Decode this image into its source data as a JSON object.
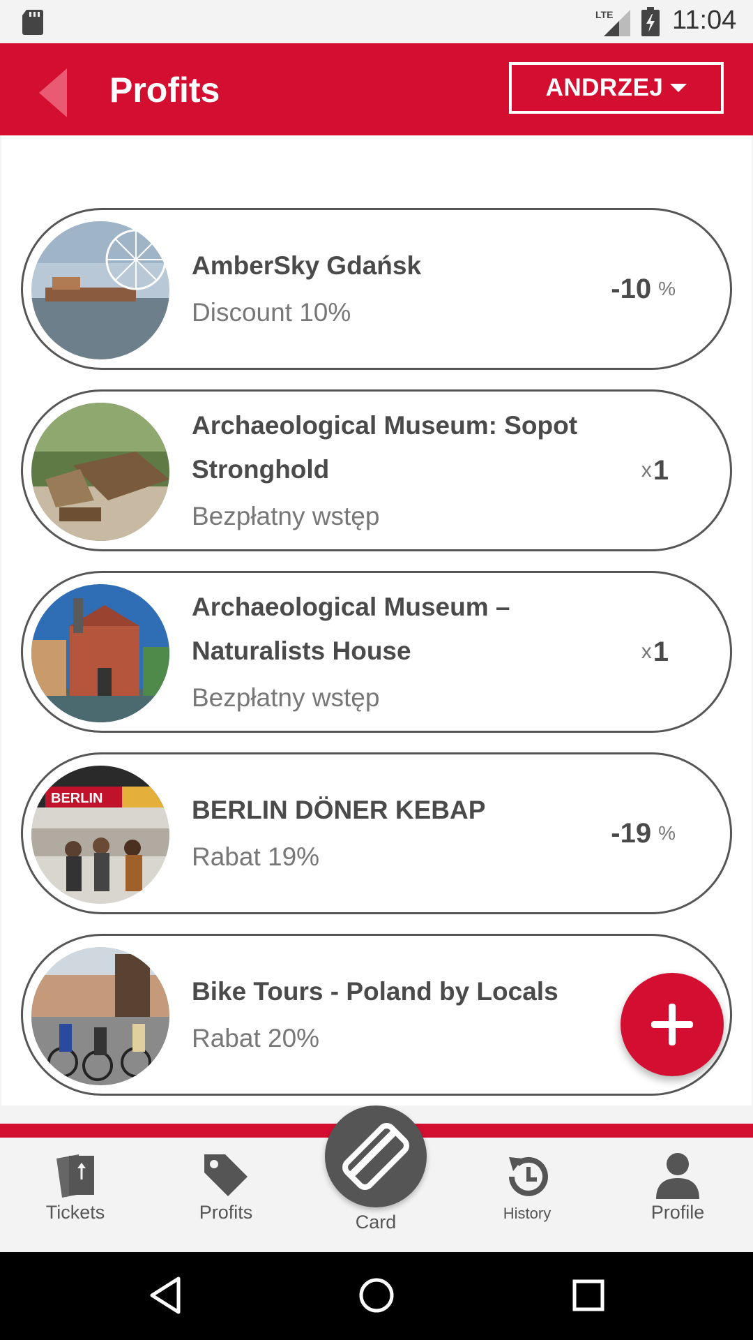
{
  "status_bar": {
    "time": "11:04",
    "network": "LTE"
  },
  "header": {
    "title": "Profits",
    "user_label": "ANDRZEJ"
  },
  "profits": [
    {
      "title": "AmberSky Gdańsk",
      "subtitle": "Discount 10%",
      "value": "-10",
      "unit": "%",
      "prefix": ""
    },
    {
      "title": "Archaeological Museum: Sopot Stronghold",
      "subtitle": "Bezpłatny wstęp",
      "value": "1",
      "unit": "",
      "prefix": "x"
    },
    {
      "title": "Archaeological Museum – Naturalists House",
      "subtitle": "Bezpłatny wstęp",
      "value": "1",
      "unit": "",
      "prefix": "x"
    },
    {
      "title": "BERLIN DÖNER KEBAP",
      "subtitle": "Rabat 19%",
      "value": "-19",
      "unit": "%",
      "prefix": ""
    },
    {
      "title": "Bike Tours - Poland by Locals",
      "subtitle": "Rabat 20%",
      "value": "-",
      "unit": "",
      "prefix": ""
    }
  ],
  "bottom_nav": {
    "tickets": "Tickets",
    "profits": "Profits",
    "card": "Card",
    "history": "History",
    "profile": "Profile"
  },
  "colors": {
    "brand_red": "#d40e30",
    "nav_gray": "#555555"
  }
}
